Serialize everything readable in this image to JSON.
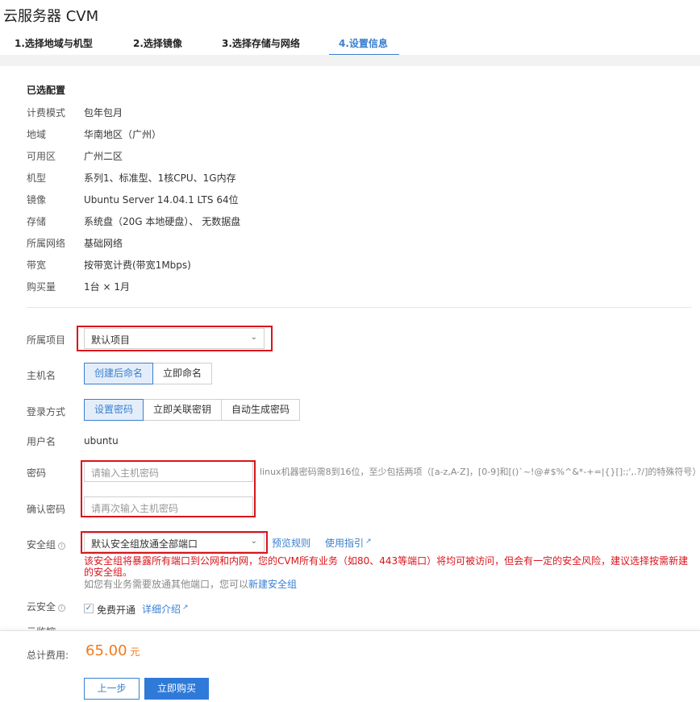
{
  "app": {
    "title": "云服务器 CVM"
  },
  "steps": [
    {
      "label": "1.选择地域与机型"
    },
    {
      "label": "2.选择镜像"
    },
    {
      "label": "3.选择存储与网络"
    },
    {
      "label": "4.设置信息"
    }
  ],
  "summary": {
    "title": "已选配置",
    "rows": [
      {
        "label": "计费模式",
        "value": "包年包月"
      },
      {
        "label": "地域",
        "value": "华南地区（广州）"
      },
      {
        "label": "可用区",
        "value": "广州二区"
      },
      {
        "label": "机型",
        "value": "系列1、标准型、1核CPU、1G内存"
      },
      {
        "label": "镜像",
        "value": "Ubuntu Server 14.04.1 LTS 64位"
      },
      {
        "label": "存储",
        "value": "系统盘（20G 本地硬盘）、 无数据盘"
      },
      {
        "label": "所属网络",
        "value": "基础网络"
      },
      {
        "label": "带宽",
        "value": "按带宽计费(带宽1Mbps)"
      },
      {
        "label": "购买量",
        "value": "1台 × 1月"
      }
    ]
  },
  "form": {
    "project": {
      "label": "所属项目",
      "value": "默认项目"
    },
    "hostname": {
      "label": "主机名",
      "options": [
        "创建后命名",
        "立即命名"
      ]
    },
    "login": {
      "label": "登录方式",
      "options": [
        "设置密码",
        "立即关联密钥",
        "自动生成密码"
      ]
    },
    "username": {
      "label": "用户名",
      "value": "ubuntu"
    },
    "password": {
      "label": "密码",
      "placeholder": "请输入主机密码",
      "hint": "linux机器密码需8到16位，至少包括两项（[a-z,A-Z]，[0-9]和[()`~!@#$%^&*-+=|{}[]:;',.?/]的特殊符号）"
    },
    "confirm": {
      "label": "确认密码",
      "placeholder": "请再次输入主机密码"
    },
    "security_group": {
      "label": "安全组",
      "value": "默认安全组放通全部端口",
      "preview_link": "预览规则",
      "guide_link": "使用指引",
      "warning": "该安全组将暴露所有端口到公网和内网，您的CVM所有业务（如80、443等端口）将均可被访问，但会有一定的安全风险，建议选择按需新建的安全组。",
      "note_prefix": "如您有业务需要放通其他端口，您可以",
      "note_link": "新建安全组"
    },
    "cloud_security": {
      "label": "云安全",
      "checkbox_label": "免费开通",
      "detail_link": "详细介绍"
    },
    "cut_label": "云监控"
  },
  "footer": {
    "total_label": "总计费用:",
    "price": "65.00",
    "unit": "元",
    "prev_label": "上一步",
    "buy_label": "立即购买"
  },
  "colors": {
    "accent": "#3a7fcf",
    "warning": "#d9141c",
    "price": "#f07a20"
  }
}
